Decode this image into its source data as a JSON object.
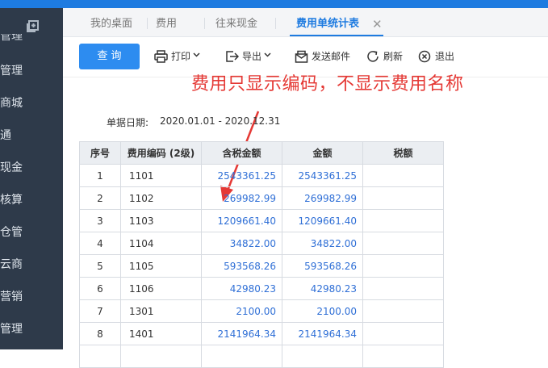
{
  "sidebar": {
    "partial_top": "管理",
    "items": [
      {
        "label": "管理"
      },
      {
        "label": "商城"
      },
      {
        "label": "通"
      },
      {
        "label": "现金"
      },
      {
        "label": "核算"
      },
      {
        "label": "仓管"
      },
      {
        "label": "云商"
      },
      {
        "label": "营销"
      },
      {
        "label": "管理"
      }
    ]
  },
  "tabs": [
    {
      "label": "我的桌面"
    },
    {
      "label": "费用"
    },
    {
      "label": "往来现金"
    },
    {
      "label": "费用单统计表"
    }
  ],
  "toolbar": {
    "query_label": "查 询",
    "print_label": "打印",
    "export_label": "导出",
    "email_label": "发送邮件",
    "refresh_label": "刷新",
    "exit_label": "退出"
  },
  "annotation": "费用只显示编码，不显示费用名称",
  "report": {
    "date_label": "单据日期:",
    "date_value": "2020.01.01 - 2020.12.31",
    "columns": [
      "序号",
      "费用编码 (2级)",
      "含税金额",
      "金额",
      "税额"
    ],
    "rows": [
      {
        "seq": "1",
        "code": "1101",
        "tax_incl": "2543361.25",
        "amount": "2543361.25",
        "tax": ""
      },
      {
        "seq": "2",
        "code": "1102",
        "tax_incl": "269982.99",
        "amount": "269982.99",
        "tax": ""
      },
      {
        "seq": "3",
        "code": "1103",
        "tax_incl": "1209661.40",
        "amount": "1209661.40",
        "tax": ""
      },
      {
        "seq": "4",
        "code": "1104",
        "tax_incl": "34822.00",
        "amount": "34822.00",
        "tax": ""
      },
      {
        "seq": "5",
        "code": "1105",
        "tax_incl": "593568.26",
        "amount": "593568.26",
        "tax": ""
      },
      {
        "seq": "6",
        "code": "1106",
        "tax_incl": "42980.23",
        "amount": "42980.23",
        "tax": ""
      },
      {
        "seq": "7",
        "code": "1301",
        "tax_incl": "2100.00",
        "amount": "2100.00",
        "tax": ""
      },
      {
        "seq": "8",
        "code": "1401",
        "tax_incl": "2141964.34",
        "amount": "2141964.34",
        "tax": ""
      },
      {
        "seq": "",
        "code": "",
        "tax_incl": "",
        "amount": "",
        "tax": ""
      }
    ]
  },
  "colors": {
    "primary": "#2d8cf0",
    "sidebar_bg": "#2e3a4a",
    "annotation": "#e53935",
    "number_text": "#2f6fd6"
  }
}
